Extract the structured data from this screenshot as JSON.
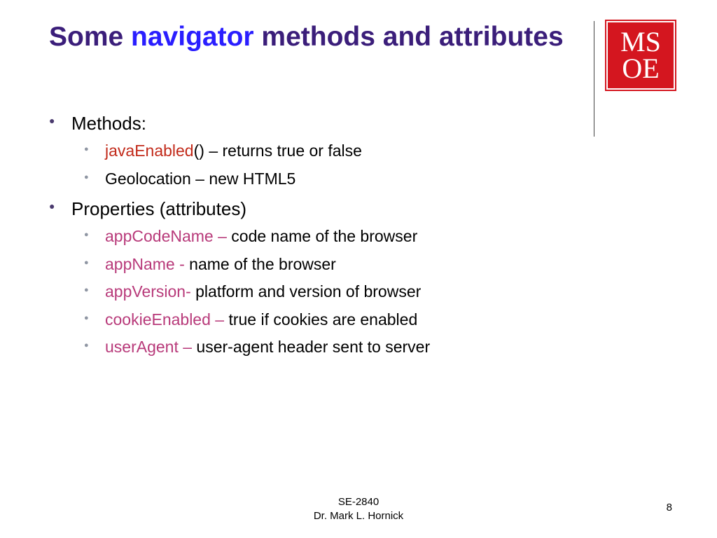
{
  "title": {
    "part1": "Some ",
    "highlight": "navigator",
    "part2": " methods and attributes"
  },
  "logo": {
    "line1": "MS",
    "line2": "OE"
  },
  "sections": {
    "methods": {
      "label": "Methods:",
      "items": [
        {
          "key": "javaEnabled",
          "rest": "() – returns true or false",
          "color": "red"
        },
        {
          "key": "",
          "rest": "Geolocation – new HTML5",
          "color": ""
        }
      ]
    },
    "props": {
      "label": "Properties (attributes)",
      "items": [
        {
          "key": "appCodeName – ",
          "rest": "code name of the browser",
          "color": "mag"
        },
        {
          "key": "appName - ",
          "rest": "name of the browser",
          "color": "mag"
        },
        {
          "key": "appVersion- ",
          "rest": "platform and version of browser",
          "color": "mag"
        },
        {
          "key": "cookieEnabled – ",
          "rest": "true if cookies are enabled",
          "color": "mag"
        },
        {
          "key": "userAgent – ",
          "rest": "user-agent header sent to server",
          "color": "mag"
        }
      ]
    }
  },
  "footer": {
    "course": "SE-2840",
    "author": "Dr. Mark L. Hornick"
  },
  "page": "8"
}
